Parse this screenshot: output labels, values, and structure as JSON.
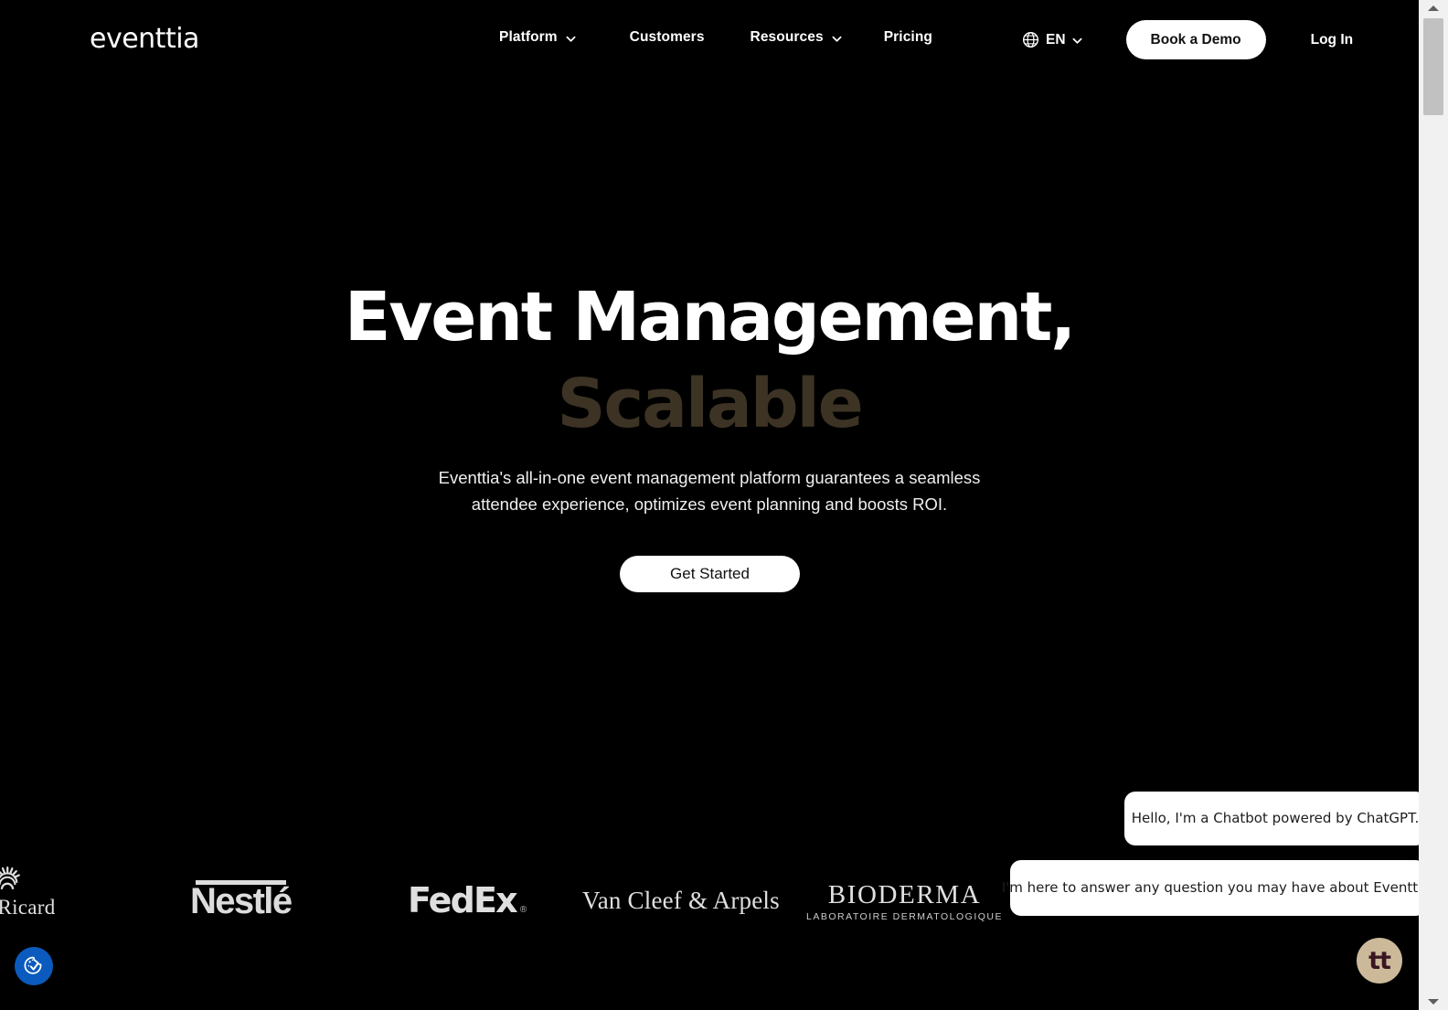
{
  "brand": {
    "name": "eventtia"
  },
  "header": {
    "nav": [
      {
        "label": "Platform",
        "has_dropdown": true,
        "icon": "chevron-down-icon"
      },
      {
        "label": "Customers",
        "has_dropdown": false
      },
      {
        "label": "Resources",
        "has_dropdown": true,
        "icon": "chevron-down-icon"
      },
      {
        "label": "Pricing",
        "has_dropdown": false
      }
    ],
    "language": {
      "icon": "globe-icon",
      "value": "EN",
      "chevron": "chevron-down-icon"
    },
    "demo_button": "Book a Demo",
    "login_link": "Log In"
  },
  "hero": {
    "title_line_1": "Event Management,",
    "title_line_2": "Scalable",
    "title_line_2_color": "#3c3324",
    "subtitle": "Eventtia's all-in-one event management platform guarantees a seamless attendee experience, optimizes event planning and boosts ROI.",
    "cta_label": "Get Started"
  },
  "logos": {
    "pernod": {
      "name": "nod Ricard",
      "icon": "sunburst-icon"
    },
    "nestle": {
      "name": "Nestlé"
    },
    "fedex": {
      "name": "FedEx",
      "registered": "®"
    },
    "vancleef": {
      "name": "Van Cleef & Arpels"
    },
    "bioderma": {
      "name": "BIODERMA",
      "tagline": "LABORATOIRE DERMATOLOGIQUE"
    }
  },
  "chat": {
    "messages": [
      "Hello, I'm a Chatbot powered by ChatGPT.",
      "I'm here to answer any question you may have about Eventtia."
    ],
    "widget_label": "tt"
  },
  "widgets": {
    "cookie_icon": "cookie-consent-icon",
    "cookie_color": "#0a5bbd",
    "chat_color": "#cbb99a"
  },
  "colors": {
    "background": "#000000",
    "text": "#ffffff",
    "accent_dark": "#3c3324"
  }
}
